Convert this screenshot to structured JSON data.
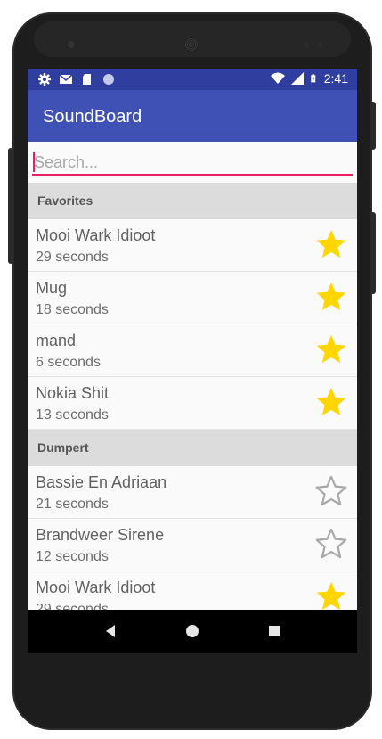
{
  "status_bar": {
    "time": "2:41",
    "left_icons": [
      "settings-icon",
      "mail-icon",
      "sd-card-icon",
      "sync-icon"
    ],
    "right_icons": [
      "wifi-icon",
      "signal-icon",
      "battery-icon"
    ]
  },
  "app_bar": {
    "title": "SoundBoard"
  },
  "search": {
    "placeholder": "Search...",
    "value": ""
  },
  "colors": {
    "primary": "#3f51b5",
    "primary_dark": "#303f9f",
    "accent": "#e91e63",
    "star_filled": "#ffd600"
  },
  "sections": [
    {
      "title": "Favorites",
      "items": [
        {
          "title": "Mooi Wark Idioot",
          "subtitle": "29 seconds",
          "favorite": true
        },
        {
          "title": "Mug",
          "subtitle": "18 seconds",
          "favorite": true
        },
        {
          "title": "mand",
          "subtitle": "6 seconds",
          "favorite": true
        },
        {
          "title": "Nokia Shit",
          "subtitle": "13 seconds",
          "favorite": true
        }
      ]
    },
    {
      "title": "Dumpert",
      "items": [
        {
          "title": "Bassie En Adriaan",
          "subtitle": "21 seconds",
          "favorite": false
        },
        {
          "title": "Brandweer Sirene",
          "subtitle": "12 seconds",
          "favorite": false
        },
        {
          "title": "Mooi Wark Idioot",
          "subtitle": "29 seconds",
          "favorite": true
        }
      ]
    }
  ],
  "nav": {
    "icons": [
      "back-icon",
      "home-icon",
      "recents-icon"
    ]
  }
}
